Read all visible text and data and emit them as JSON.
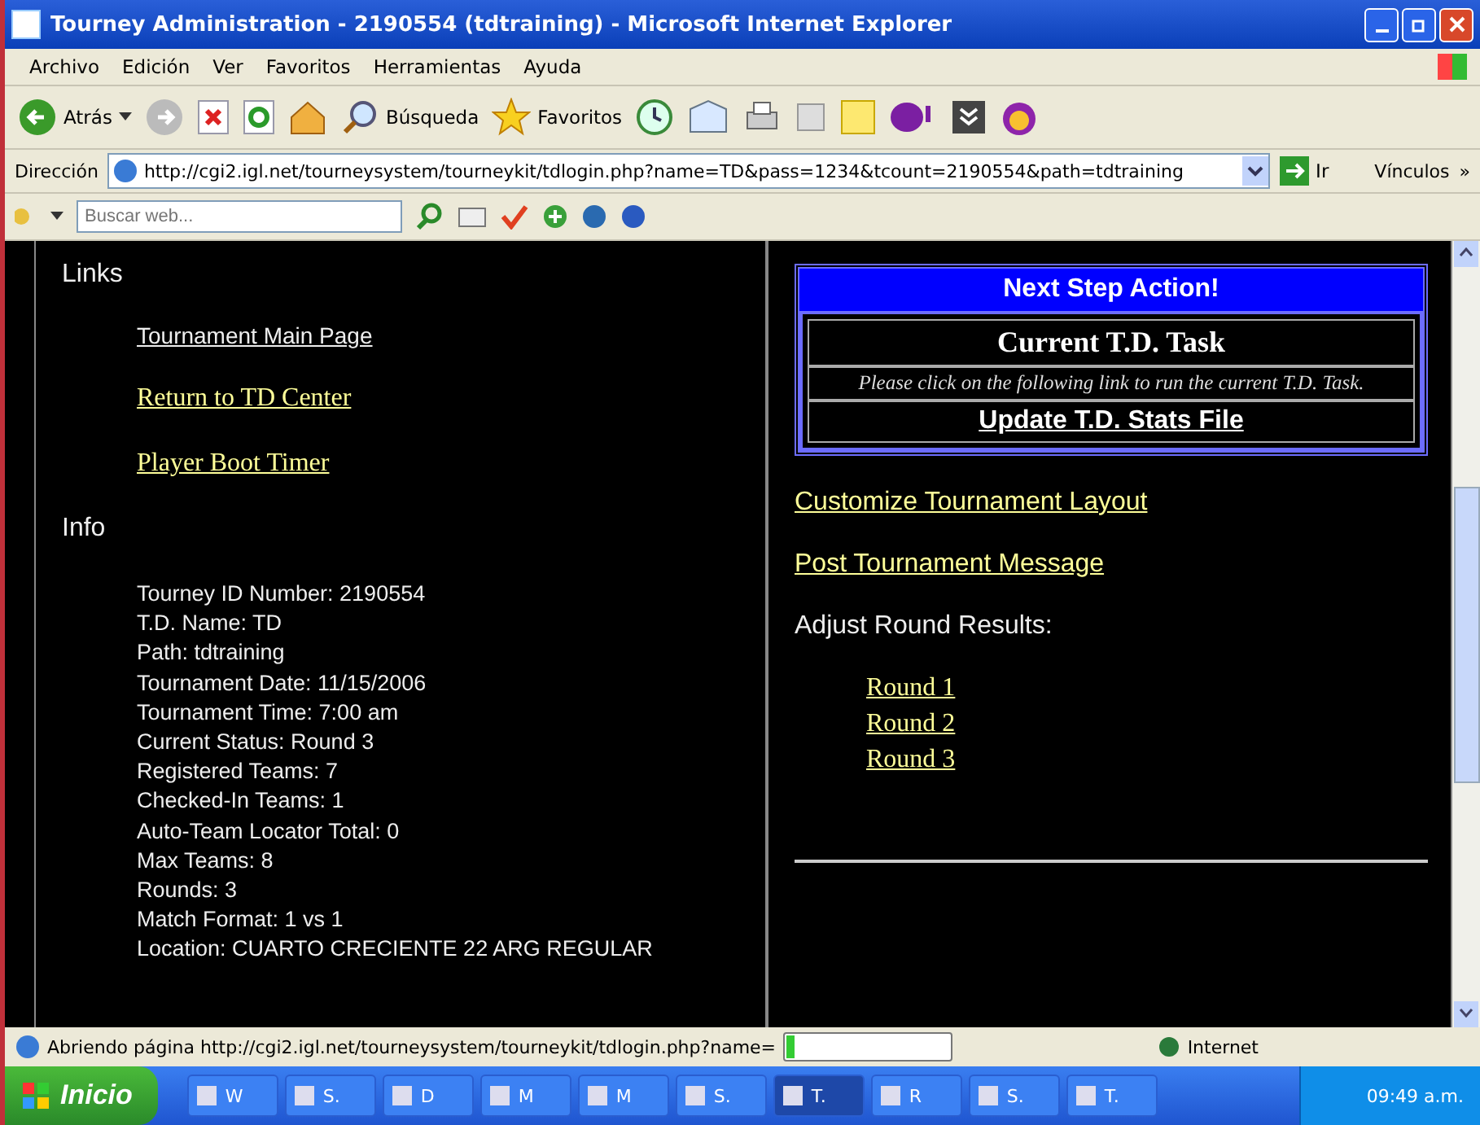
{
  "window": {
    "title": "Tourney Administration - 2190554 (tdtraining) - Microsoft Internet Explorer"
  },
  "menu_bar": [
    "Archivo",
    "Edición",
    "Ver",
    "Favoritos",
    "Herramientas",
    "Ayuda"
  ],
  "toolbar": {
    "back_label": "Atrás",
    "search_label": "Búsqueda",
    "favorites_label": "Favoritos"
  },
  "address_bar": {
    "label": "Dirección",
    "url": "http://cgi2.igl.net/tourneysystem/tourneykit/tdlogin.php?name=TD&pass=1234&tcount=2190554&path=tdtraining",
    "go_label": "Ir",
    "links_label": "Vínculos",
    "more": "»"
  },
  "search_toolbar": {
    "placeholder": "Buscar web..."
  },
  "page": {
    "links_heading": "Links",
    "links": [
      {
        "text": "Tournament Main Page",
        "kind": "sans"
      },
      {
        "text": "Return to TD Center",
        "kind": "serif"
      },
      {
        "text": "Player Boot Timer",
        "kind": "serif"
      }
    ],
    "info_heading": "Info",
    "info": [
      "Tourney ID Number: 2190554",
      "T.D. Name: TD",
      "Path: tdtraining",
      "Tournament Date: 11/15/2006",
      "Tournament Time: 7:00 am",
      "Current Status: Round 3",
      "Registered Teams: 7",
      "Checked-In Teams: 1",
      "Auto-Team Locator Total: 0",
      "Max Teams: 8",
      "Rounds: 3",
      "Match Format: 1 vs 1",
      "Location: CUARTO CRECIENTE 22 ARG REGULAR"
    ],
    "next_step": {
      "title": "Next Step Action!",
      "task_heading": "Current T.D. Task",
      "task_text": "Please click on the following link to run the current T.D. Task.",
      "task_link": "Update T.D. Stats File"
    },
    "actions": [
      "Customize Tournament Layout",
      "Post Tournament Message"
    ],
    "adjust_heading": "Adjust Round Results:",
    "rounds": [
      "Round 1",
      "Round 2",
      "Round 3"
    ]
  },
  "status_bar": {
    "text": "Abriendo página http://cgi2.igl.net/tourneysystem/tourneykit/tdlogin.php?name=",
    "level": 0.05,
    "zone": "Internet"
  },
  "taskbar": {
    "start": "Inicio",
    "items": [
      {
        "label": "W",
        "selected": false
      },
      {
        "label": "S.",
        "selected": false
      },
      {
        "label": "D",
        "selected": false
      },
      {
        "label": "M",
        "selected": false
      },
      {
        "label": "M",
        "selected": false
      },
      {
        "label": "S.",
        "selected": false
      },
      {
        "label": "T.",
        "selected": true
      },
      {
        "label": "R",
        "selected": false
      },
      {
        "label": "S.",
        "selected": false
      },
      {
        "label": "T.",
        "selected": false
      }
    ],
    "clock": "09:49 a.m."
  }
}
